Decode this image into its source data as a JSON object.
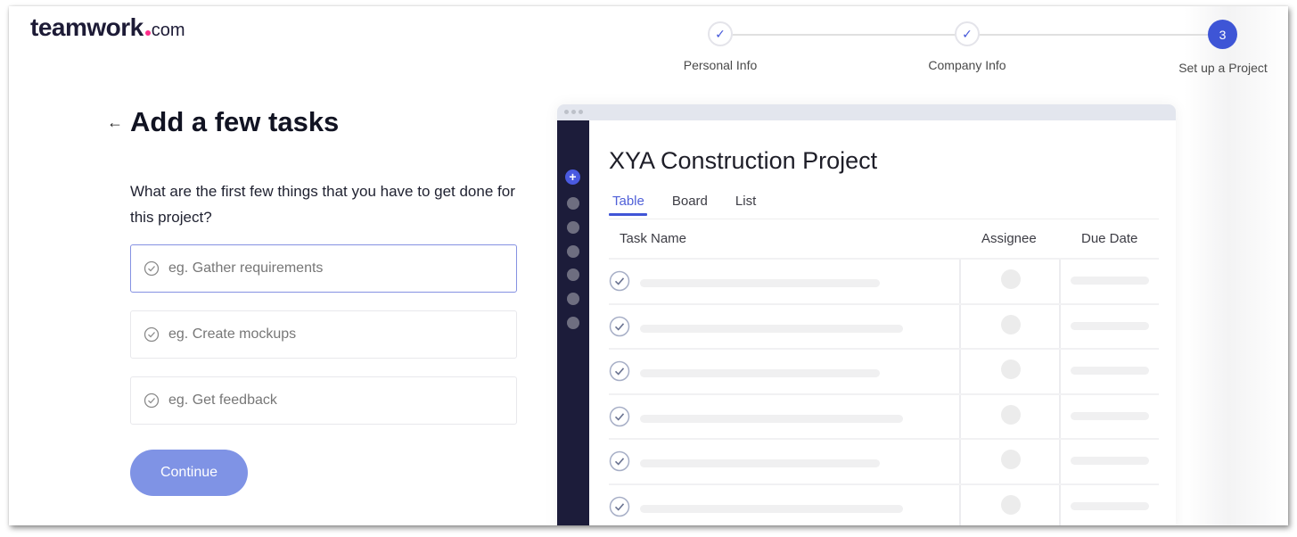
{
  "brand": {
    "name": "teamwork",
    "suffix": "com",
    "dot_color": "#ff2d8a"
  },
  "stepper": {
    "steps": [
      {
        "label": "Personal Info",
        "state": "done",
        "icon": "check-icon"
      },
      {
        "label": "Company Info",
        "state": "done",
        "icon": "check-icon"
      },
      {
        "label": "Set up a Project",
        "state": "active",
        "number": "3"
      }
    ],
    "active_color": "#3e55d6"
  },
  "form": {
    "back_icon": "arrow-left-icon",
    "title": "Add a few tasks",
    "question": "What are the first few things that you have to get done for this project?",
    "tasks": [
      {
        "value": "",
        "placeholder": "eg. Gather requirements",
        "focused": true
      },
      {
        "value": "",
        "placeholder": "eg. Create mockups",
        "focused": false
      },
      {
        "value": "",
        "placeholder": "eg. Get feedback",
        "focused": false
      }
    ],
    "continue_label": "Continue",
    "continue_color": "#7f93e5"
  },
  "preview": {
    "project_title": "XYA Construction Project",
    "tabs": [
      {
        "label": "Table",
        "active": true
      },
      {
        "label": "Board",
        "active": false
      },
      {
        "label": "List",
        "active": false
      }
    ],
    "columns": [
      "Task Name",
      "Assignee",
      "Due Date"
    ],
    "rows": [
      {
        "name_skeleton": "short"
      },
      {
        "name_skeleton": "long"
      },
      {
        "name_skeleton": "short"
      },
      {
        "name_skeleton": "long"
      },
      {
        "name_skeleton": "short"
      },
      {
        "name_skeleton": "long"
      }
    ],
    "sidebar_color": "#1c1c3a",
    "accent_color": "#4055d6"
  }
}
